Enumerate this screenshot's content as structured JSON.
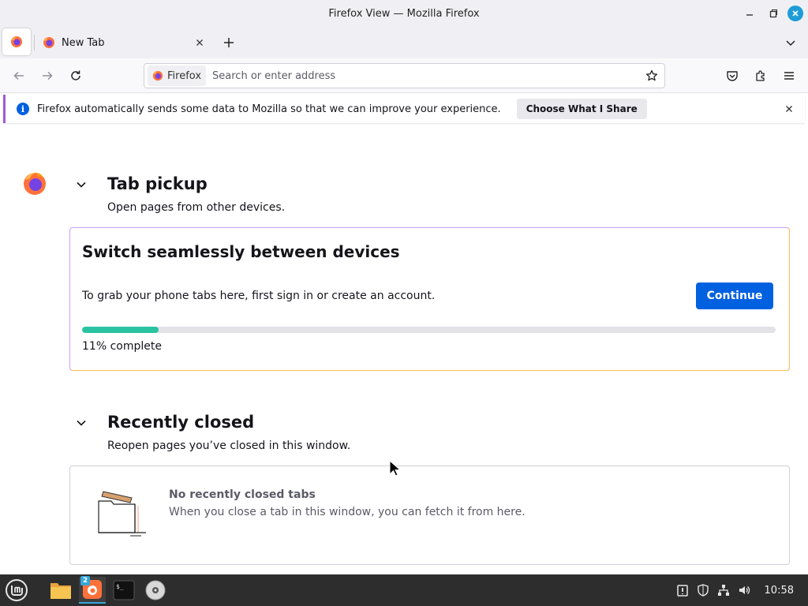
{
  "window": {
    "title": "Firefox View — Mozilla Firefox",
    "controls": [
      "minimize",
      "maximize",
      "close"
    ]
  },
  "tabs": {
    "items": [
      {
        "label": "New Tab",
        "icon": "firefox-logo-icon"
      }
    ],
    "new_tab_icon": "plus-icon",
    "list_all_tabs_icon": "chevron-down-icon"
  },
  "navbar": {
    "identity_label": "Firefox",
    "address_placeholder": "Search or enter address",
    "buttons": [
      "back",
      "forward",
      "reload",
      "bookmark-star",
      "pocket",
      "extensions",
      "menu"
    ]
  },
  "notification": {
    "text": "Firefox automatically sends some data to Mozilla so that we can improve your experience.",
    "action_label": "Choose What I Share"
  },
  "tab_pickup": {
    "title": "Tab pickup",
    "subtitle": "Open pages from other devices.",
    "card": {
      "title": "Switch seamlessly between devices",
      "description": "To grab your phone tabs here, first sign in or create an account.",
      "button_label": "Continue",
      "progress_fraction": 0.11,
      "progress_text": "11% complete"
    }
  },
  "recently_closed": {
    "title": "Recently closed",
    "subtitle": "Reopen pages you’ve closed in this window.",
    "empty_title": "No recently closed tabs",
    "empty_description": "When you close a tab in this window, you can fetch it from here."
  },
  "taskbar": {
    "items": [
      "mint-menu-icon",
      "files-folder-icon",
      "firefox-icon",
      "terminal-icon",
      "disc-icon"
    ],
    "firefox_badge": "2",
    "tray": [
      "update-icon",
      "shield-icon",
      "network-icon",
      "volume-icon"
    ],
    "clock": "10:58"
  },
  "colors": {
    "accent": "#0061e0",
    "progress": "#2ac3a2",
    "taskbar": "#2d2d2d",
    "notification_border": "#a05ad6"
  }
}
